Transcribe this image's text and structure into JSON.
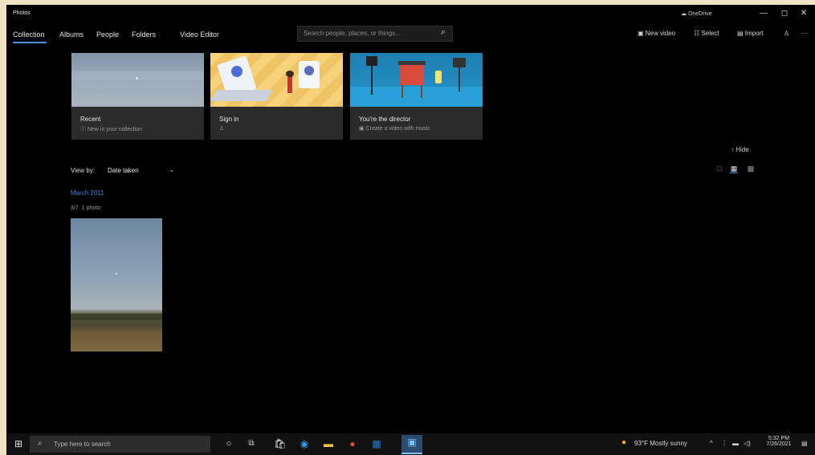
{
  "window": {
    "title": "Photos",
    "onedrive_label": "OneDrive",
    "minimize": "—",
    "maximize": "◻",
    "close": "✕"
  },
  "nav": {
    "tabs": [
      "Collection",
      "Albums",
      "People",
      "Folders",
      "Video Editor"
    ],
    "active_tab": "Collection"
  },
  "search": {
    "placeholder": "Search people, places, or things..."
  },
  "commands": {
    "new_video": "New video",
    "select": "Select",
    "import": "Import",
    "more": "···"
  },
  "cards": [
    {
      "title": "Recent",
      "subtitle": "New in your collection"
    },
    {
      "title": "Sign in",
      "subtitle": ""
    },
    {
      "title": "You're the director",
      "subtitle": "Create a video with music"
    }
  ],
  "hide_label": "Hide",
  "view_by": {
    "label": "View by:",
    "value": "Date taken"
  },
  "gallery": {
    "month": "March 2011",
    "day": "3/7",
    "count": "1 photo"
  },
  "taskbar": {
    "search_placeholder": "Type here to search",
    "weather": "93°F  Mostly sunny",
    "time": "5:32 PM",
    "date": "7/26/2021"
  },
  "colors": {
    "accent": "#3f86d6",
    "window_bg": "#000000",
    "card_bg": "#2b2b2b"
  }
}
